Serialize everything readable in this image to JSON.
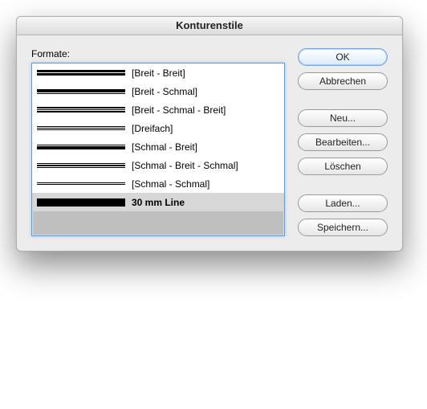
{
  "title": "Konturenstile",
  "list_label": "Formate:",
  "styles": [
    {
      "label": "[Breit - Breit]",
      "pattern": "bb",
      "selected": false
    },
    {
      "label": "[Breit - Schmal]",
      "pattern": "bs",
      "selected": false
    },
    {
      "label": "[Breit - Schmal - Breit]",
      "pattern": "bsb",
      "selected": false
    },
    {
      "label": "[Dreifach]",
      "pattern": "ddd",
      "selected": false
    },
    {
      "label": "[Schmal - Breit]",
      "pattern": "sb",
      "selected": false
    },
    {
      "label": "[Schmal - Breit - Schmal]",
      "pattern": "sbs",
      "selected": false
    },
    {
      "label": "[Schmal - Schmal]",
      "pattern": "ss",
      "selected": false
    },
    {
      "label": "30 mm Line",
      "pattern": "solid",
      "selected": true
    }
  ],
  "buttons": {
    "ok": "OK",
    "cancel": "Abbrechen",
    "new": "Neu...",
    "edit": "Bearbeiten...",
    "delete": "Löschen",
    "load": "Laden...",
    "save": "Speichern..."
  }
}
